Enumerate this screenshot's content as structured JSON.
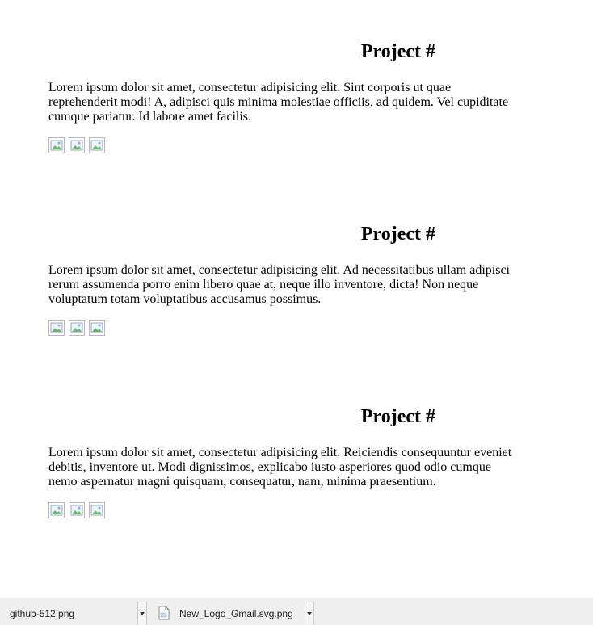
{
  "projects": [
    {
      "title": "Project #",
      "description": "Lorem ipsum dolor sit amet, consectetur adipisicing elit. Sint corporis ut quae reprehenderit modi! A, adipisci quis minima molestiae officiis, ad quidem. Vel cupiditate cumque pariatur. Id labore amet facilis."
    },
    {
      "title": "Project #",
      "description": "Lorem ipsum dolor sit amet, consectetur adipisicing elit. Ad necessitatibus ullam adipisci rerum assumenda porro enim libero quae at, neque illo inventore, dicta! Non neque voluptatum totam voluptatibus accusamus possimus."
    },
    {
      "title": "Project #",
      "description": "Lorem ipsum dolor sit amet, consectetur adipisicing elit. Reiciendis consequuntur eveniet debitis, inventore ut. Modi dignissimos, explicabo iusto asperiores quod odio cumque nemo aspernatur magni quisquam, consequatur, nam, minima praesentium."
    }
  ],
  "downloads": [
    {
      "filename": "github-512.png",
      "icon": "image-file-icon"
    },
    {
      "filename": "New_Logo_Gmail.svg.png",
      "icon": "image-file-icon"
    }
  ]
}
